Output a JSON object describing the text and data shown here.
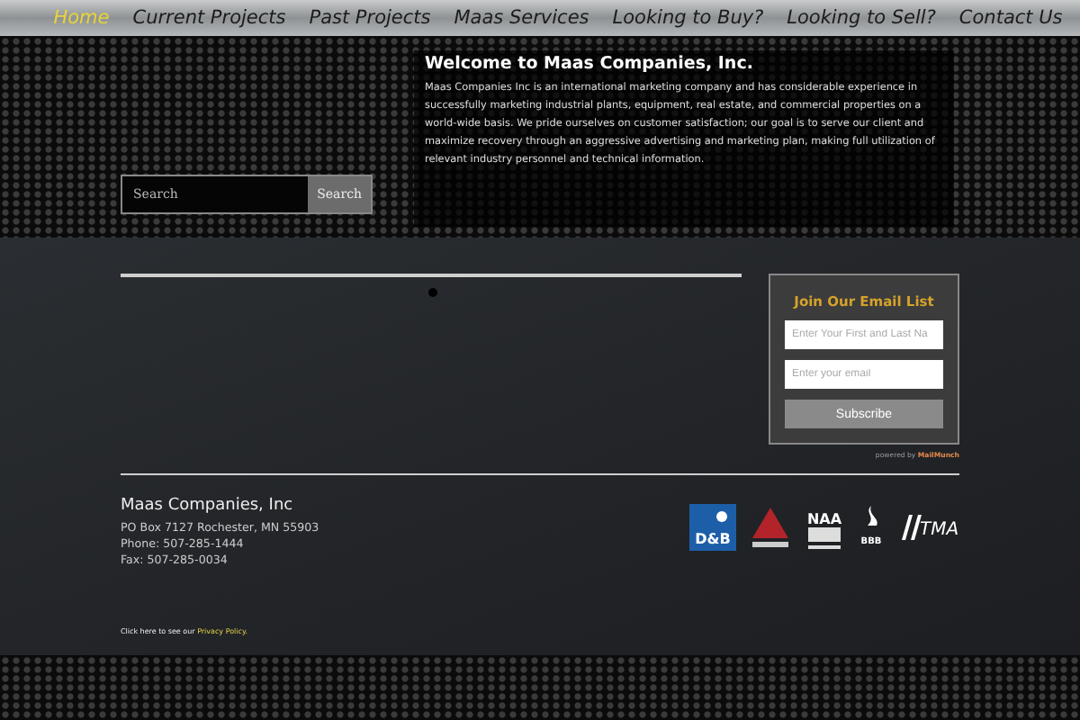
{
  "nav": [
    {
      "label": "Home",
      "selected": true
    },
    {
      "label": "Current Projects",
      "selected": false
    },
    {
      "label": "Past Projects",
      "selected": false
    },
    {
      "label": "Maas Services",
      "selected": false
    },
    {
      "label": "Looking to Buy?",
      "selected": false
    },
    {
      "label": "Looking to Sell?",
      "selected": false
    },
    {
      "label": "Contact Us",
      "selected": false
    }
  ],
  "search": {
    "placeholder": "Search",
    "button": "Search"
  },
  "welcome": {
    "title": "Welcome to Maas Companies, Inc.",
    "text": "Maas Companies Inc is an international marketing company and has considerable experience in successfully marketing industrial plants, equipment, real estate, and commercial properties on a world-wide basis. We pride ourselves on customer satisfaction; our goal is to serve our client and maximize recovery through an aggressive advertising and marketing plan, making full utilization of relevant industry personnel and technical information."
  },
  "email_signup": {
    "title": "Join Our Email List",
    "name_placeholder": "Enter Your First and Last Na",
    "email_placeholder": "Enter your email",
    "button": "Subscribe",
    "powered_by": "powered by",
    "brand": "MailMunch"
  },
  "footer": {
    "company": "Maas Companies, Inc",
    "lines": [
      "PO Box 7127 Rochester, MN 55903",
      "Phone: 507-285-1444",
      "Fax: 507-285-0034"
    ],
    "privacy_prefix": "Click here to see our",
    "privacy_link": "Privacy Policy."
  },
  "logos": [
    {
      "kind": "dnb",
      "text": "D&B"
    },
    {
      "kind": "triangle"
    },
    {
      "kind": "naa",
      "text": "NAA"
    },
    {
      "kind": "bbb",
      "text": "BBB"
    },
    {
      "kind": "tma",
      "text": "TMA"
    }
  ]
}
